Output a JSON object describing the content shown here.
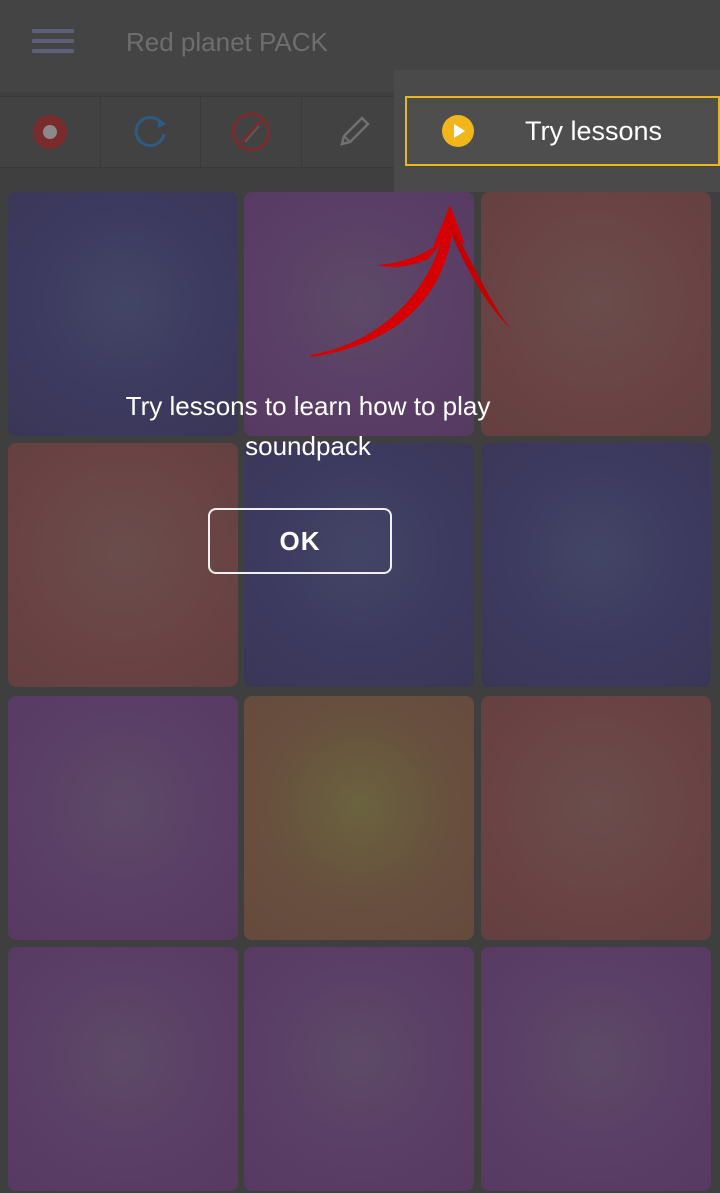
{
  "app": {
    "title": "Red planet PACK"
  },
  "toolbar": {
    "tools": [
      {
        "icon": "record-icon"
      },
      {
        "icon": "loop-icon"
      },
      {
        "icon": "mute-icon"
      },
      {
        "icon": "pencil-icon"
      }
    ]
  },
  "lessons": {
    "button_label": "Try lessons",
    "icon": "play-icon",
    "accent": "#e8b81a"
  },
  "overlay": {
    "message": "Try lessons to learn how to play soundpack",
    "ok_label": "OK",
    "arrow_color": "#e00000"
  },
  "pads": [
    {
      "color": "blue"
    },
    {
      "color": "purple"
    },
    {
      "color": "red"
    },
    {
      "color": "red"
    },
    {
      "color": "blue"
    },
    {
      "color": "blue"
    },
    {
      "color": "purple"
    },
    {
      "color": "olive"
    },
    {
      "color": "red"
    },
    {
      "color": "purple"
    },
    {
      "color": "purple"
    },
    {
      "color": "purple"
    }
  ]
}
